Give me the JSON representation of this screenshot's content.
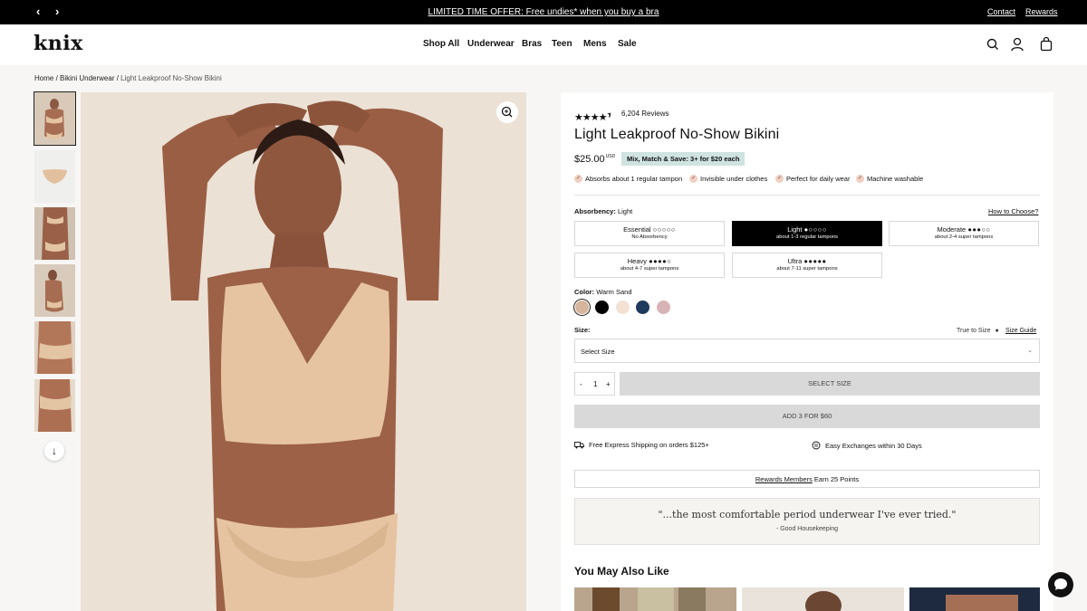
{
  "promo_bar": {
    "offer": "LIMITED TIME OFFER: Free undies* when you buy a bra",
    "contact": "Contact",
    "rewards": "Rewards",
    "prev_icon": "chevron-left-icon",
    "next_icon": "chevron-right-icon"
  },
  "header": {
    "logo": "knix",
    "nav": [
      "Shop All",
      "Underwear",
      "Bras",
      "Teen",
      "Mens",
      "Sale"
    ],
    "icons": [
      "search-icon",
      "account-icon",
      "cart-icon"
    ]
  },
  "breadcrumb": {
    "home": "Home",
    "sep1": " / ",
    "category": "Bikini Underwear",
    "sep2": " / ",
    "current": "Light Leakproof No-Show Bikini"
  },
  "product": {
    "rating_stars": 4.5,
    "reviews": "6,204 Reviews",
    "title": "Light Leakproof No-Show Bikini",
    "price": "$25.00",
    "currency": "USD",
    "promo": "Mix, Match & Save: 3+ for $20 each",
    "features": [
      "Absorbs about 1 regular tampon",
      "Invisible under clothes",
      "Perfect for daily wear",
      "Machine washable"
    ],
    "absorbency_label": "Absorbency:",
    "absorbency_value": "Light",
    "how_to_choose": "How to Choose?",
    "absorbency_options": [
      {
        "name": "Essential",
        "sub": "No Absorbency",
        "drops": "○○○○○",
        "selected": false
      },
      {
        "name": "Light",
        "sub": "about 1-3 regular tampons",
        "drops": "●○○○○",
        "selected": true
      },
      {
        "name": "Moderate",
        "sub": "about 2-4 super tampons",
        "drops": "●●●○○",
        "selected": false
      },
      {
        "name": "Heavy",
        "sub": "about 4-7 super tampons",
        "drops": "●●●●○",
        "selected": false
      },
      {
        "name": "Ultra",
        "sub": "about 7-11 super tampons",
        "drops": "●●●●●",
        "selected": false
      }
    ],
    "color_label": "Color:",
    "color_value": "Warm Sand",
    "colors": [
      "#d6b59c",
      "#000000",
      "#f3e1d4",
      "#1e3a5c",
      "#d8b3b5"
    ],
    "size_label": "Size:",
    "true_to_size": "True to Size",
    "size_guide": "Size Guide",
    "size_placeholder": "Select Size",
    "qty_minus": "-",
    "qty_value": "1",
    "qty_plus": "+",
    "select_size_btn": "SELECT SIZE",
    "add3_btn": "ADD 3 FOR $60",
    "shipping": "Free Express Shipping on orders $125+",
    "exchanges": "Easy Exchanges within 30 Days",
    "rewards_link": "Rewards Members",
    "rewards_text": " Earn 25 Points",
    "quote": "\"...the most comfortable period underwear I've ever tried.\"",
    "quote_source": "- Good Housekeeping",
    "also_like": "You May Also Like"
  },
  "colors": {
    "promo_bg": "#000000",
    "badge_bg": "#cfe3e0",
    "check_bg": "#f1cfc2"
  }
}
